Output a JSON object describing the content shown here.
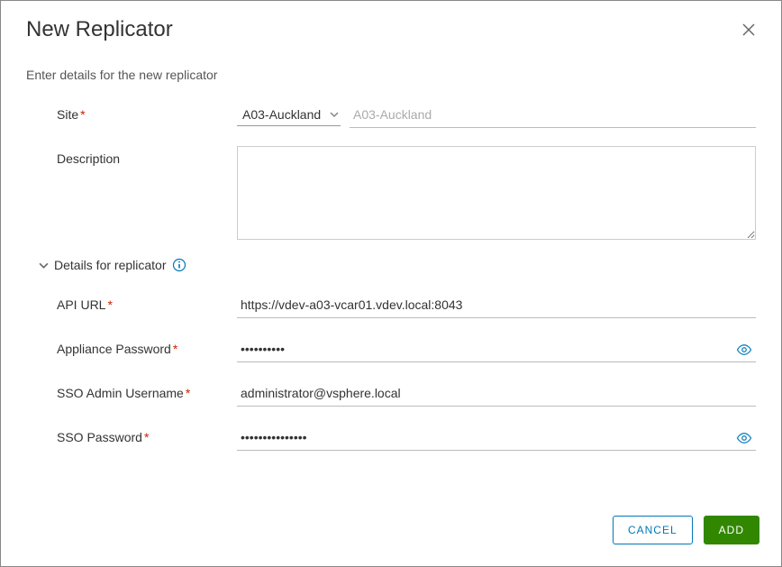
{
  "dialog": {
    "title": "New Replicator",
    "subtitle": "Enter details for the new replicator"
  },
  "form": {
    "site": {
      "label": "Site",
      "selected": "A03-Auckland",
      "display": "A03-Auckland"
    },
    "description": {
      "label": "Description",
      "value": ""
    },
    "section_title": "Details for replicator",
    "api_url": {
      "label": "API URL",
      "value": "https://vdev-a03-vcar01.vdev.local:8043"
    },
    "appliance_password": {
      "label": "Appliance Password",
      "value": "••••••••••"
    },
    "sso_username": {
      "label": "SSO Admin Username",
      "value": "administrator@vsphere.local"
    },
    "sso_password": {
      "label": "SSO Password",
      "value": "•••••••••••••••"
    }
  },
  "footer": {
    "cancel": "CANCEL",
    "add": "ADD"
  }
}
